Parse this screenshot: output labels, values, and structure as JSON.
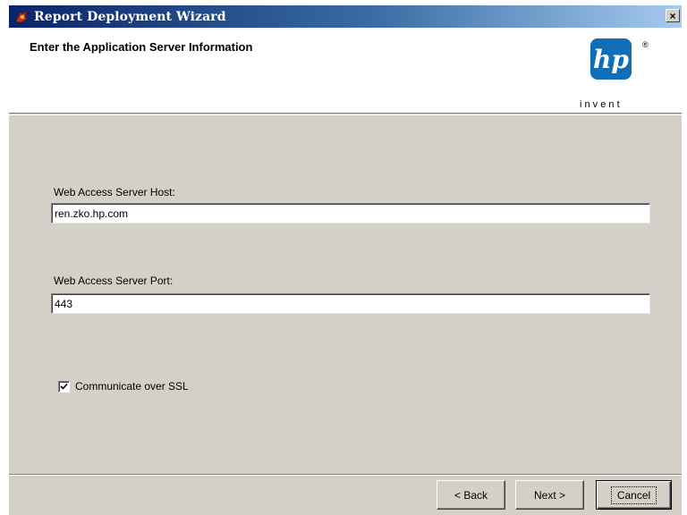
{
  "window": {
    "title": "Report Deployment Wizard",
    "close_label": "×"
  },
  "header": {
    "title": "Enter the Application Server Information",
    "logo": {
      "mark_text": "hp",
      "tagline": "i n v e n t",
      "registered_mark": "®"
    }
  },
  "form": {
    "host": {
      "label": "Web Access Server Host:",
      "value": "ren.zko.hp.com"
    },
    "port": {
      "label": "Web Access Server Port:",
      "value": "443"
    },
    "ssl": {
      "label": "Communicate over SSL",
      "checked": true
    }
  },
  "buttons": {
    "back": "< Back",
    "next": "Next >",
    "cancel": "Cancel"
  },
  "icons": {
    "app": "wizard-app-icon",
    "close": "close-icon",
    "check": "checkmark-icon"
  },
  "colors": {
    "titlebar_start": "#0a246a",
    "titlebar_end": "#a6caf0",
    "logo_blue": "#0f6eb5",
    "dialog_face": "#d4d0c8"
  }
}
